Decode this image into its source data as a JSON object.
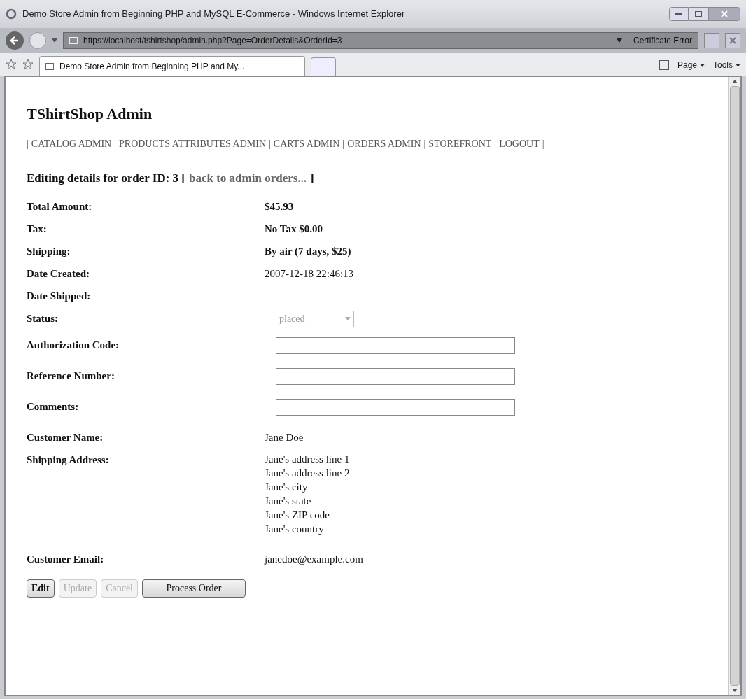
{
  "window": {
    "title": "Demo Store Admin from Beginning PHP and MySQL E-Commerce - Windows Internet Explorer"
  },
  "address_bar": {
    "url": "https://localhost/tshirtshop/admin.php?Page=OrderDetails&OrderId=3",
    "certificate": "Certificate Error"
  },
  "tabs": [
    {
      "label": "Demo Store Admin from Beginning PHP and My...",
      "selected": true
    }
  ],
  "toolbar": {
    "page": "Page",
    "tools": "Tools"
  },
  "page": {
    "title": "TShirtShop Admin",
    "nav": [
      {
        "kind": "separator",
        "text": "|"
      },
      {
        "kind": "link",
        "text": "CATALOG ADMIN"
      },
      {
        "kind": "separator",
        "text": "|"
      },
      {
        "kind": "link",
        "text": "PRODUCTS ATTRIBUTES ADMIN"
      },
      {
        "kind": "separator",
        "text": "|"
      },
      {
        "kind": "link",
        "text": "CARTS ADMIN"
      },
      {
        "kind": "separator",
        "text": "|"
      },
      {
        "kind": "link",
        "text": "ORDERS ADMIN"
      },
      {
        "kind": "separator",
        "text": "|"
      },
      {
        "kind": "link",
        "text": "STOREFRONT"
      },
      {
        "kind": "separator",
        "text": "|"
      },
      {
        "kind": "link",
        "text": "LOGOUT"
      },
      {
        "kind": "separator",
        "text": "|"
      }
    ],
    "heading": {
      "text": "Editing details for order ID: 3 [",
      "link": "back to admin orders...",
      "close": "]"
    },
    "fields": [
      {
        "label": "Total Amount:",
        "kind": "bold",
        "value": "$45.93"
      },
      {
        "label": "Tax:",
        "kind": "bold",
        "value": "No Tax $0.00"
      },
      {
        "label": "Shipping:",
        "kind": "bold",
        "value": "By air (7 days, $25)"
      },
      {
        "label": "Date Created:",
        "kind": "text",
        "value": "2007-12-18 22:46:13"
      },
      {
        "label": "Date Shipped:",
        "kind": "empty"
      },
      {
        "label": "Status:",
        "kind": "select",
        "value": "placed",
        "disabled": true
      },
      {
        "label": "Authorization Code:",
        "kind": "input"
      },
      {
        "label": "Reference Number:",
        "kind": "input"
      },
      {
        "label": "Comments:",
        "kind": "input"
      },
      {
        "label": "Customer Name:",
        "kind": "text",
        "value": "Jane Doe"
      },
      {
        "label": "Shipping Address:",
        "kind": "lines",
        "lines": [
          "Jane's address line 1",
          "Jane's address line 2",
          "Jane's city",
          "Jane's state",
          "Jane's ZIP code",
          "Jane's country"
        ]
      },
      {
        "label": "Customer Email:",
        "kind": "text",
        "value": "janedoe@example.com"
      }
    ],
    "buttons": [
      {
        "label": "Edit",
        "disabled": false
      },
      {
        "label": "Update",
        "disabled": true
      },
      {
        "label": "Cancel",
        "disabled": true
      },
      {
        "label": "Process Order",
        "disabled": false
      }
    ]
  }
}
